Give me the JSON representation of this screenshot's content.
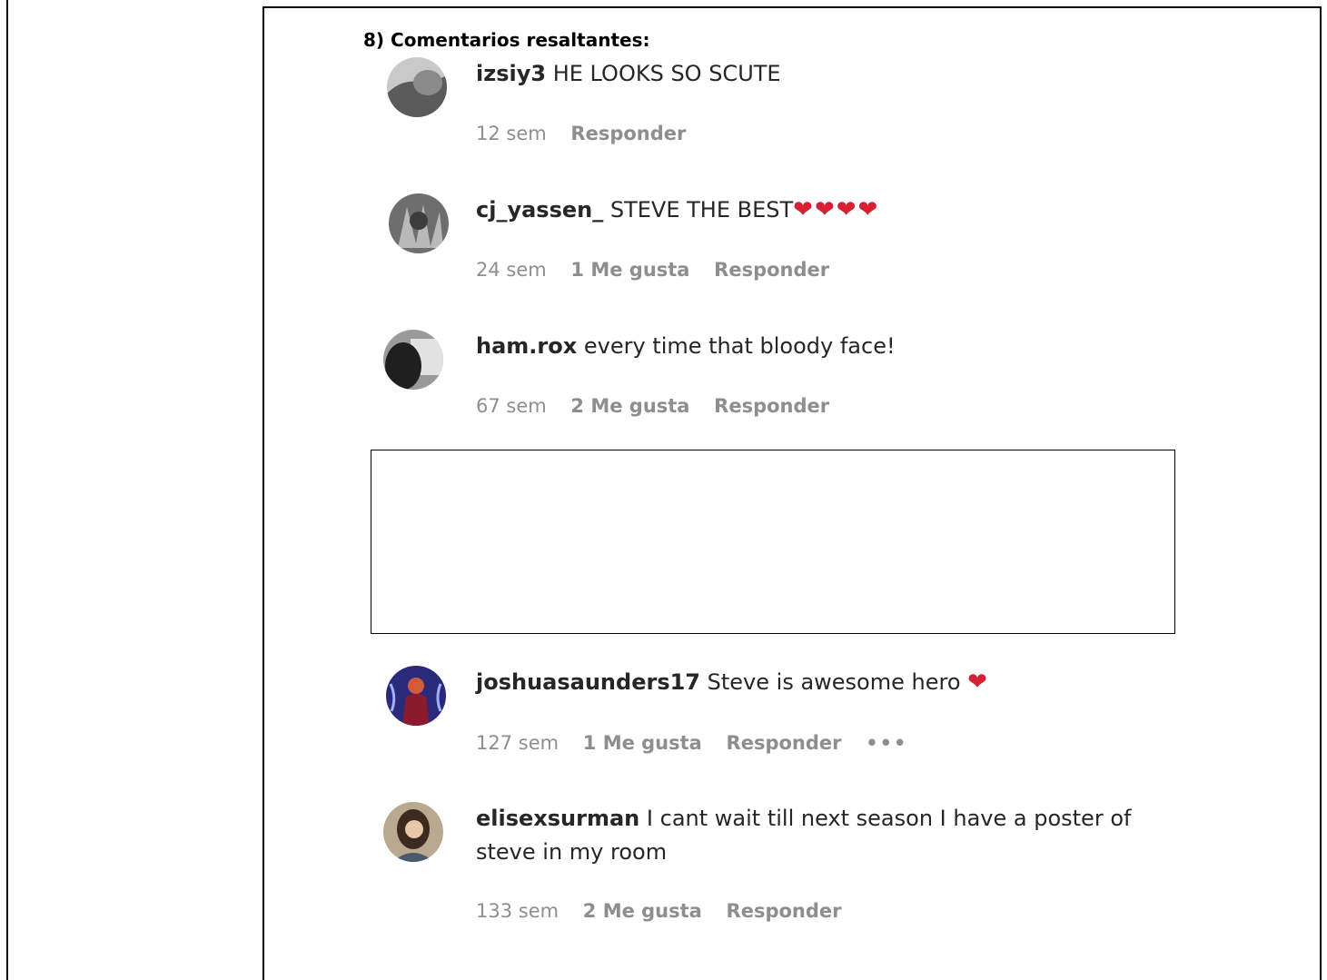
{
  "section_title": "8) Comentarios resaltantes:",
  "comments": [
    {
      "username": "izsiy3",
      "text": "HE LOOKS SO SCUTE",
      "hearts": "",
      "time": "12 sem",
      "likes": "",
      "reply": "Responder",
      "more": ""
    },
    {
      "username": "cj_yassen_",
      "text": "STEVE THE BEST",
      "hearts": "❤❤❤❤",
      "time": "24 sem",
      "likes": "1 Me gusta",
      "reply": "Responder",
      "more": ""
    },
    {
      "username": "ham.rox",
      "text": "every time that bloody face!",
      "hearts": "",
      "time": "67 sem",
      "likes": "2 Me gusta",
      "reply": "Responder",
      "more": ""
    },
    {
      "username": "joshuasaunders17",
      "text": "Steve is awesome hero",
      "hearts": "❤",
      "time": "127 sem",
      "likes": "1 Me gusta",
      "reply": "Responder",
      "more": "•••"
    },
    {
      "username": "elisexsurman",
      "text": "I cant wait till next season I have a poster of steve in my room",
      "hearts": "",
      "time": "133 sem",
      "likes": "2 Me gusta",
      "reply": "Responder",
      "more": ""
    }
  ],
  "colors": {
    "text": "#262626",
    "meta": "#8e8e8e",
    "heart": "#d62033",
    "border": "#000000"
  }
}
